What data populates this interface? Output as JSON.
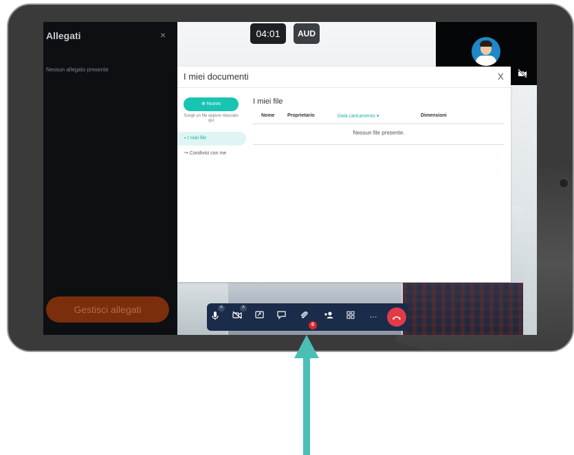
{
  "call": {
    "timer": "04:01",
    "label": "AUD"
  },
  "sidebar": {
    "title": "Allegati",
    "close": "×",
    "empty_text": "Nessun allegato presente",
    "manage_button": "Gestisci allegati"
  },
  "modal": {
    "title": "I miei documenti",
    "close": "X",
    "new_button": "Nuovo",
    "drop_hint": "Scegli un file oppure rilascialo qui",
    "nav": [
      {
        "label": "I miei file",
        "icon": "file-icon",
        "active": true
      },
      {
        "label": "Condivisi con me",
        "icon": "share-icon",
        "active": false
      }
    ],
    "section_title": "I miei file",
    "columns": [
      "Nome",
      "Proprietario",
      "Data caricamento",
      "Dimensioni"
    ],
    "sort_indicator": "▾",
    "empty_text": "Nessun file presente."
  },
  "toolbar": {
    "buttons": [
      "microphone-icon",
      "camera-off-icon",
      "share-screen-icon",
      "chat-icon",
      "attachment-icon",
      "add-participant-icon",
      "grid-icon",
      "more-icon",
      "hangup-icon"
    ],
    "attachment_badge": "0",
    "more_label": "···"
  },
  "colors": {
    "accent": "#18c4b2",
    "toolbar": "#1b2b4a",
    "hangup": "#e03b46",
    "arrow": "#4bbfb6",
    "manage_button": "#7a2e0c"
  }
}
